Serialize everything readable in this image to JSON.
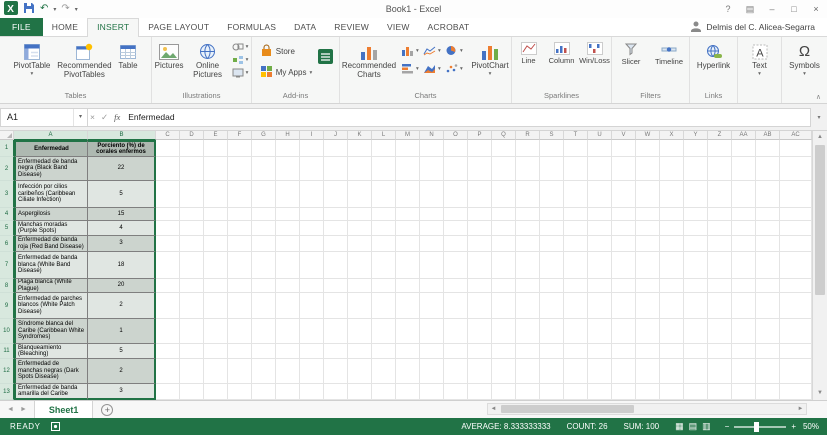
{
  "window": {
    "title": "Book1 - Excel"
  },
  "tabs": [
    {
      "label": "FILE",
      "file": true,
      "active": false
    },
    {
      "label": "HOME",
      "file": false,
      "active": false
    },
    {
      "label": "INSERT",
      "file": false,
      "active": true
    },
    {
      "label": "PAGE LAYOUT",
      "file": false,
      "active": false
    },
    {
      "label": "FORMULAS",
      "file": false,
      "active": false
    },
    {
      "label": "DATA",
      "file": false,
      "active": false
    },
    {
      "label": "REVIEW",
      "file": false,
      "active": false
    },
    {
      "label": "VIEW",
      "file": false,
      "active": false
    },
    {
      "label": "ACROBAT",
      "file": false,
      "active": false
    }
  ],
  "user_name": "Delmis del C. Alicea-Segarra",
  "ribbon": {
    "tables_label": "Tables",
    "pivottable": "PivotTable",
    "recommended_pivottables": "Recommended PivotTables",
    "table": "Table",
    "illustrations_label": "Illustrations",
    "pictures": "Pictures",
    "online_pictures": "Online Pictures",
    "addins_label": "Add-ins",
    "store": "Store",
    "my_apps": "My Apps",
    "charts_label": "Charts",
    "recommended_charts": "Recommended Charts",
    "pivotchart": "PivotChart",
    "sparklines_label": "Sparklines",
    "spark_line": "Line",
    "spark_column": "Column",
    "spark_winloss": "Win/Loss",
    "filters_label": "Filters",
    "slicer": "Slicer",
    "timeline": "Timeline",
    "links_label": "Links",
    "hyperlink": "Hyperlink",
    "text_button": "Text",
    "symbols_button": "Symbols"
  },
  "formula_bar": {
    "name_box": "A1",
    "content": "Enfermedad"
  },
  "grid": {
    "col_letters": [
      "A",
      "B",
      "C",
      "D",
      "E",
      "F",
      "G",
      "H",
      "I",
      "J",
      "K",
      "L",
      "M",
      "N",
      "O",
      "P",
      "Q",
      "R",
      "S",
      "T",
      "U",
      "V",
      "W",
      "X",
      "Y",
      "Z",
      "AA",
      "AB",
      "AC"
    ],
    "selected_cols": [
      "A",
      "B"
    ],
    "rows": [
      {
        "n": "1",
        "a": "Enfermedad",
        "b": "Porciento (%) de corales enfermos",
        "type": "header"
      },
      {
        "n": "2",
        "a": "Enfermedad de banda negra (Black Band Disease)",
        "b": "22"
      },
      {
        "n": "3",
        "a": "Infección por cilios caribeños (Caribbean Ciliate Infection)",
        "b": "5"
      },
      {
        "n": "4",
        "a": "Aspergilosis",
        "b": "15"
      },
      {
        "n": "5",
        "a": "Manchas moradas (Purple Spots)",
        "b": "4"
      },
      {
        "n": "6",
        "a": "Enfermedad de banda roja (Red Band Disease)",
        "b": "3"
      },
      {
        "n": "7",
        "a": "Enfermedad de banda blanca (White Band Disease)",
        "b": "18"
      },
      {
        "n": "8",
        "a": "Plaga blanca (White Plague)",
        "b": "20"
      },
      {
        "n": "9",
        "a": "Enfermedad de parches blancos (White Patch Disease)",
        "b": "2"
      },
      {
        "n": "10",
        "a": "Síndrome blanca del Caribe (Caribbean White Syndromes)",
        "b": "1"
      },
      {
        "n": "11",
        "a": "Blanqueamiento (Bleaching)",
        "b": "5"
      },
      {
        "n": "12",
        "a": "Enfermedad de manchas negras (Dark Spots Disease)",
        "b": "2"
      },
      {
        "n": "13",
        "a": "Enfermedad de banda amarilla del Caribe",
        "b": "3"
      }
    ]
  },
  "sheet": {
    "tab": "Sheet1"
  },
  "status_bar": {
    "mode": "READY",
    "average": "AVERAGE: 8.333333333",
    "count": "COUNT: 26",
    "sum": "SUM: 100",
    "zoom": "50%"
  },
  "icons": {
    "help": "?",
    "ribbon_options": "▤",
    "minimize": "–",
    "maximize": "□",
    "close": "×",
    "undo": "↶",
    "redo": "↷",
    "caret": "▾",
    "view_normal": "▦",
    "view_page_layout": "▤",
    "view_page_break": "▥",
    "zoom_out": "−",
    "zoom_in": "+",
    "formula_cancel": "×",
    "formula_enter": "✓",
    "formula_fx": "fx",
    "scroll_up": "▲",
    "scroll_down": "▼",
    "scroll_left": "◄",
    "scroll_right": "►",
    "sheet_nav_left": "◄",
    "sheet_nav_right": "►",
    "add_sheet": "+",
    "omega": "Ω",
    "collapse_ribbon": "∧"
  }
}
